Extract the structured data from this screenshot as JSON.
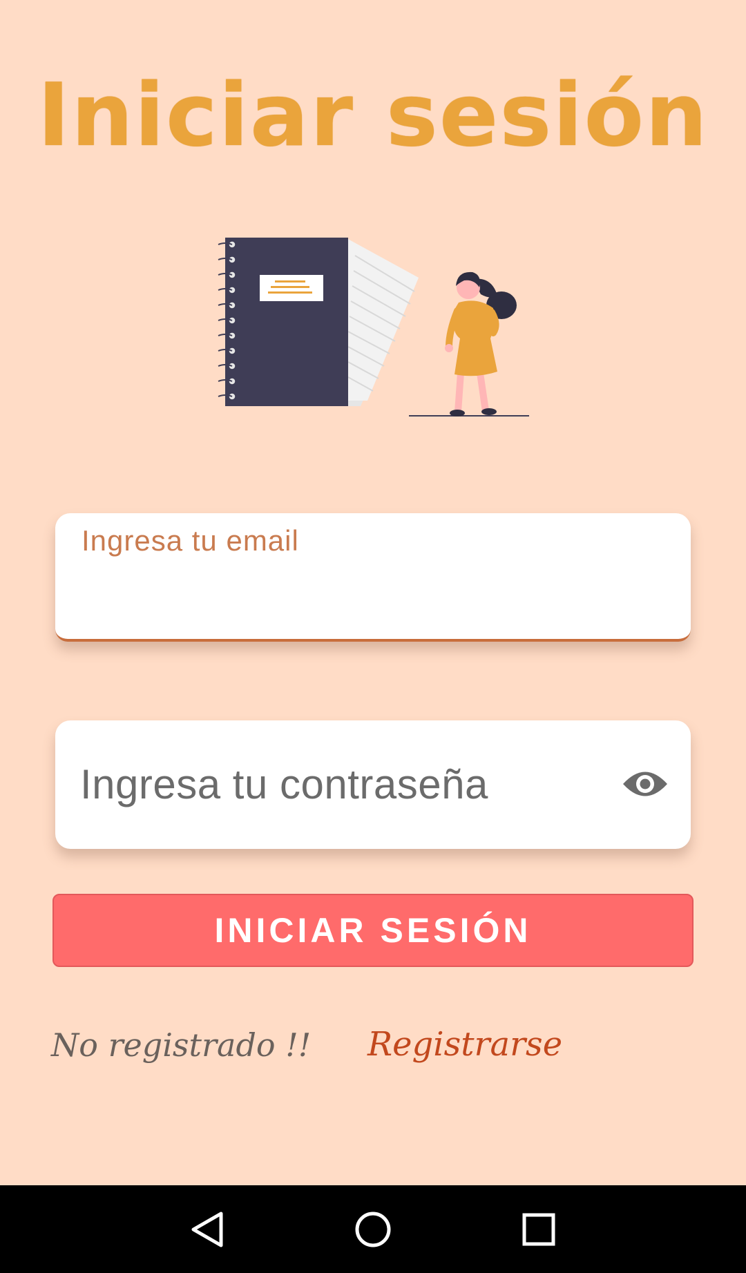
{
  "screen": {
    "title": "Iniciar sesión"
  },
  "illustration": {
    "icon": "notebook-woman-illustration",
    "colors": {
      "notebook": "#3f3d56",
      "accent": "#eaa43c",
      "skin": "#ffb6b6"
    }
  },
  "form": {
    "email_label": "Ingresa tu email",
    "email_value": "",
    "password_placeholder": "Ingresa tu contraseña",
    "password_toggle_icon": "eye-icon",
    "submit_label": "INICIAR SESIÓN"
  },
  "footer": {
    "prompt": "No registrado !!",
    "register_link": "Registrarse"
  },
  "system_nav": {
    "back_icon": "back-triangle-icon",
    "home_icon": "home-circle-icon",
    "recents_icon": "recents-square-icon"
  },
  "colors": {
    "background": "#ffdcc6",
    "title": "#eaa43c",
    "button": "#ff6b6b",
    "link": "#c2481d",
    "field_underline": "#c86d3c"
  }
}
